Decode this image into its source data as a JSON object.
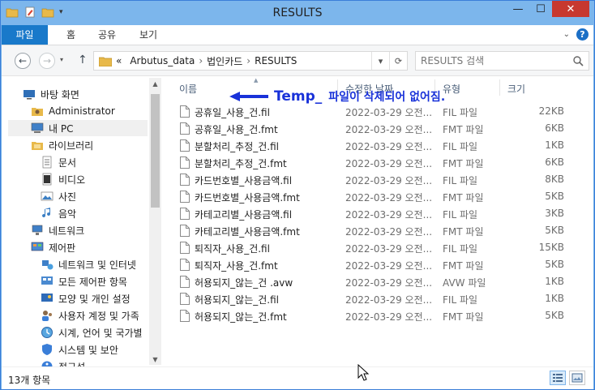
{
  "window": {
    "title": "RESULTS"
  },
  "ribbon": {
    "tabs": [
      "파일",
      "홈",
      "공유",
      "보기"
    ]
  },
  "address": {
    "overflow": "«",
    "crumbs": [
      "Arbutus_data",
      "법인카드",
      "RESULTS"
    ],
    "separator": "›"
  },
  "search": {
    "placeholder": "RESULTS 검색"
  },
  "nav_items": [
    {
      "label": "바탕 화면",
      "icon": "desktop-icon"
    },
    {
      "label": "Administrator",
      "icon": "user-folder-icon"
    },
    {
      "label": "내 PC",
      "icon": "computer-icon"
    },
    {
      "label": "라이브러리",
      "icon": "library-icon"
    },
    {
      "label": "문서",
      "icon": "documents-icon"
    },
    {
      "label": "비디오",
      "icon": "videos-icon"
    },
    {
      "label": "사진",
      "icon": "pictures-icon"
    },
    {
      "label": "음악",
      "icon": "music-icon"
    },
    {
      "label": "네트워크",
      "icon": "network-icon"
    },
    {
      "label": "제어판",
      "icon": "control-panel-icon"
    },
    {
      "label": "네트워크 및 인터넷",
      "icon": "network-internet-icon"
    },
    {
      "label": "모든 제어판 항목",
      "icon": "all-control-panel-icon"
    },
    {
      "label": "모양 및 개인 설정",
      "icon": "appearance-icon"
    },
    {
      "label": "사용자 계정 및 가족",
      "icon": "user-accounts-icon"
    },
    {
      "label": "시계, 언어 및 국가별",
      "icon": "clock-region-icon"
    },
    {
      "label": "시스템 및 보안",
      "icon": "system-security-icon"
    },
    {
      "label": "접근성",
      "icon": "accessibility-icon"
    }
  ],
  "columns": {
    "name": "이름",
    "date": "수정한 날짜",
    "type": "유형",
    "size": "크기"
  },
  "annotation": {
    "bold": "Temp_",
    "text": "파일이 삭제되어 없어짐."
  },
  "files": [
    {
      "name": "공휴일_사용_건.fil",
      "date": "2022-03-29 오전...",
      "type": "FIL 파일",
      "size": "22KB"
    },
    {
      "name": "공휴일_사용_건.fmt",
      "date": "2022-03-29 오전...",
      "type": "FMT 파일",
      "size": "6KB"
    },
    {
      "name": "분할처리_추정_건.fil",
      "date": "2022-03-29 오전...",
      "type": "FIL 파일",
      "size": "1KB"
    },
    {
      "name": "분할처리_추정_건.fmt",
      "date": "2022-03-29 오전...",
      "type": "FMT 파일",
      "size": "6KB"
    },
    {
      "name": "카드번호별_사용금액.fil",
      "date": "2022-03-29 오전...",
      "type": "FIL 파일",
      "size": "8KB"
    },
    {
      "name": "카드번호별_사용금액.fmt",
      "date": "2022-03-29 오전...",
      "type": "FMT 파일",
      "size": "5KB"
    },
    {
      "name": "카테고리별_사용금액.fil",
      "date": "2022-03-29 오전...",
      "type": "FIL 파일",
      "size": "3KB"
    },
    {
      "name": "카테고리별_사용금액.fmt",
      "date": "2022-03-29 오전...",
      "type": "FMT 파일",
      "size": "5KB"
    },
    {
      "name": "퇴직자_사용_건.fil",
      "date": "2022-03-29 오전...",
      "type": "FIL 파일",
      "size": "15KB"
    },
    {
      "name": "퇴직자_사용_건.fmt",
      "date": "2022-03-29 오전...",
      "type": "FMT 파일",
      "size": "5KB"
    },
    {
      "name": "허용되지_않는_건 .avw",
      "date": "2022-03-29 오전...",
      "type": "AVW 파일",
      "size": "1KB"
    },
    {
      "name": "허용되지_않는_건.fil",
      "date": "2022-03-29 오전...",
      "type": "FIL 파일",
      "size": "1KB"
    },
    {
      "name": "허용되지_않는_건.fmt",
      "date": "2022-03-29 오전...",
      "type": "FMT 파일",
      "size": "5KB"
    }
  ],
  "status": {
    "item_count": "13개 항목"
  },
  "colors": {
    "accent": "#1979ca",
    "annotation": "#1932d9",
    "close": "#c7382f"
  }
}
